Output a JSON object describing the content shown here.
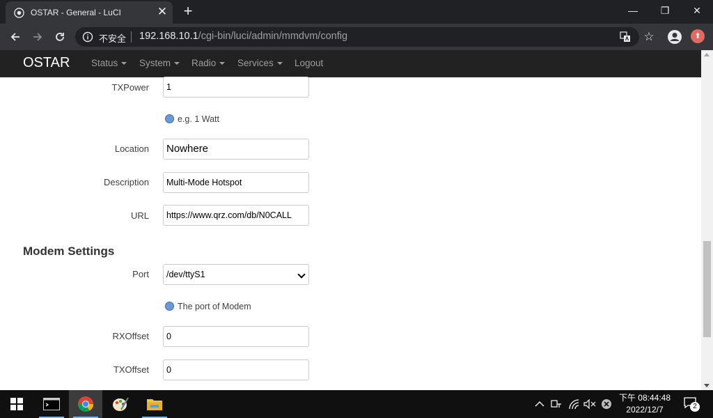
{
  "browser": {
    "tab_title": "OSTAR - General - LuCI",
    "tab_close": "✕",
    "new_tab": "+",
    "insecure_label": "不安全",
    "url_host": "192.168.10.1",
    "url_path": "/cgi-bin/luci/admin/mmdvm/config",
    "window_controls": {
      "minimize": "—",
      "restore": "❐",
      "close": "✕"
    }
  },
  "nav": {
    "brand": "OSTAR",
    "menus": [
      "Status",
      "System",
      "Radio",
      "Services"
    ],
    "logout": "Logout"
  },
  "form": {
    "txpower": {
      "label": "TXPower",
      "value": "1",
      "hint": "e.g. 1 Watt"
    },
    "location": {
      "label": "Location",
      "value": "Nowhere"
    },
    "description": {
      "label": "Description",
      "value": "Multi-Mode Hotspot"
    },
    "url": {
      "label": "URL",
      "value": "https://www.qrz.com/db/N0CALL"
    },
    "modem_section_title": "Modem Settings",
    "port": {
      "label": "Port",
      "value": "/dev/ttyS1",
      "hint": "The port of Modem"
    },
    "rxoffset": {
      "label": "RXOffset",
      "value": "0"
    },
    "txoffset": {
      "label": "TXOffset",
      "value": "0"
    }
  },
  "taskbar": {
    "time": "下午 08:44:48",
    "date": "2022/12/7",
    "notification_count": "2"
  }
}
